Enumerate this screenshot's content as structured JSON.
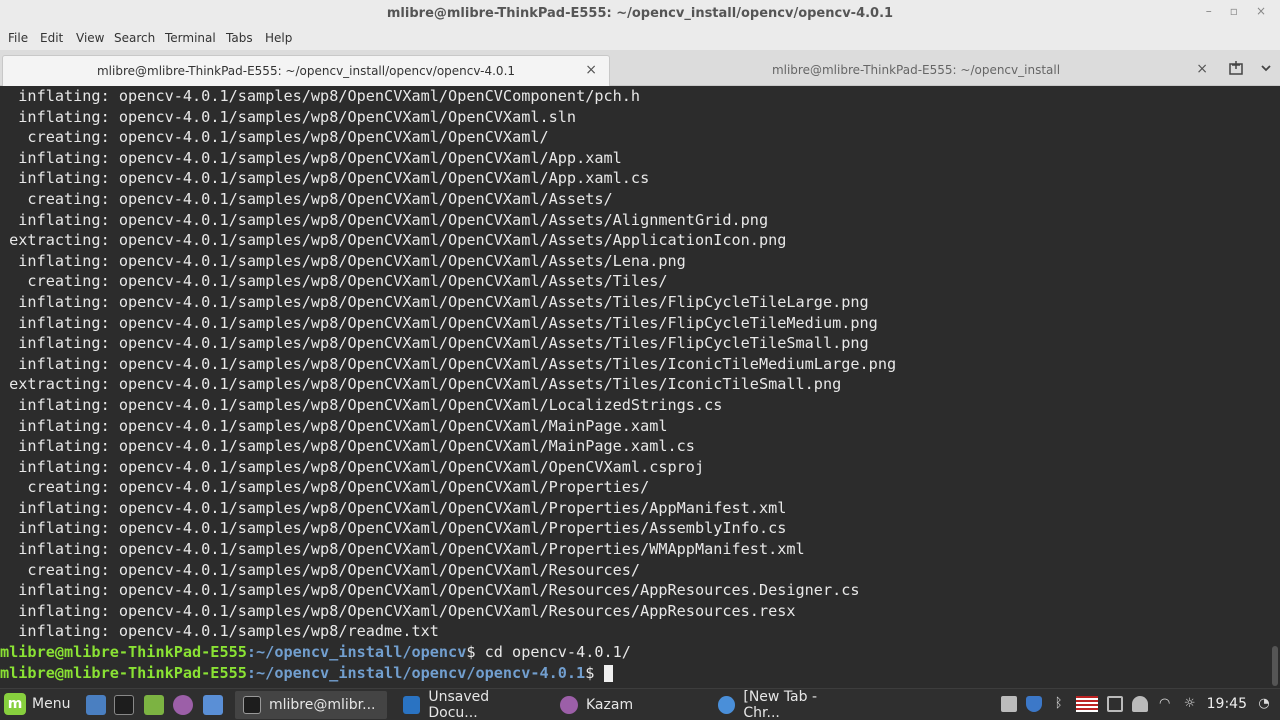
{
  "window": {
    "title": "mlibre@mlibre-ThinkPad-E555: ~/opencv_install/opencv/opencv-4.0.1",
    "controls": [
      "–",
      "▫",
      "×"
    ]
  },
  "menubar": [
    "File",
    "Edit",
    "View",
    "Search",
    "Terminal",
    "Tabs",
    "Help"
  ],
  "tabs": [
    {
      "label": "mlibre@mlibre-ThinkPad-E555: ~/opencv_install/opencv/opencv-4.0.1",
      "close": "×",
      "active": true
    },
    {
      "label": "mlibre@mlibre-ThinkPad-E555: ~/opencv_install",
      "close": "×",
      "active": false
    }
  ],
  "terminal": {
    "output": [
      {
        "verb": "  inflating:",
        "path": "opencv-4.0.1/samples/wp8/OpenCVXaml/OpenCVComponent/pch.h"
      },
      {
        "verb": "  inflating:",
        "path": "opencv-4.0.1/samples/wp8/OpenCVXaml/OpenCVXaml.sln"
      },
      {
        "verb": "   creating:",
        "path": "opencv-4.0.1/samples/wp8/OpenCVXaml/OpenCVXaml/"
      },
      {
        "verb": "  inflating:",
        "path": "opencv-4.0.1/samples/wp8/OpenCVXaml/OpenCVXaml/App.xaml"
      },
      {
        "verb": "  inflating:",
        "path": "opencv-4.0.1/samples/wp8/OpenCVXaml/OpenCVXaml/App.xaml.cs"
      },
      {
        "verb": "   creating:",
        "path": "opencv-4.0.1/samples/wp8/OpenCVXaml/OpenCVXaml/Assets/"
      },
      {
        "verb": "  inflating:",
        "path": "opencv-4.0.1/samples/wp8/OpenCVXaml/OpenCVXaml/Assets/AlignmentGrid.png"
      },
      {
        "verb": " extracting:",
        "path": "opencv-4.0.1/samples/wp8/OpenCVXaml/OpenCVXaml/Assets/ApplicationIcon.png"
      },
      {
        "verb": "  inflating:",
        "path": "opencv-4.0.1/samples/wp8/OpenCVXaml/OpenCVXaml/Assets/Lena.png"
      },
      {
        "verb": "   creating:",
        "path": "opencv-4.0.1/samples/wp8/OpenCVXaml/OpenCVXaml/Assets/Tiles/"
      },
      {
        "verb": "  inflating:",
        "path": "opencv-4.0.1/samples/wp8/OpenCVXaml/OpenCVXaml/Assets/Tiles/FlipCycleTileLarge.png"
      },
      {
        "verb": "  inflating:",
        "path": "opencv-4.0.1/samples/wp8/OpenCVXaml/OpenCVXaml/Assets/Tiles/FlipCycleTileMedium.png"
      },
      {
        "verb": "  inflating:",
        "path": "opencv-4.0.1/samples/wp8/OpenCVXaml/OpenCVXaml/Assets/Tiles/FlipCycleTileSmall.png"
      },
      {
        "verb": "  inflating:",
        "path": "opencv-4.0.1/samples/wp8/OpenCVXaml/OpenCVXaml/Assets/Tiles/IconicTileMediumLarge.png"
      },
      {
        "verb": " extracting:",
        "path": "opencv-4.0.1/samples/wp8/OpenCVXaml/OpenCVXaml/Assets/Tiles/IconicTileSmall.png"
      },
      {
        "verb": "  inflating:",
        "path": "opencv-4.0.1/samples/wp8/OpenCVXaml/OpenCVXaml/LocalizedStrings.cs"
      },
      {
        "verb": "  inflating:",
        "path": "opencv-4.0.1/samples/wp8/OpenCVXaml/OpenCVXaml/MainPage.xaml"
      },
      {
        "verb": "  inflating:",
        "path": "opencv-4.0.1/samples/wp8/OpenCVXaml/OpenCVXaml/MainPage.xaml.cs"
      },
      {
        "verb": "  inflating:",
        "path": "opencv-4.0.1/samples/wp8/OpenCVXaml/OpenCVXaml/OpenCVXaml.csproj"
      },
      {
        "verb": "   creating:",
        "path": "opencv-4.0.1/samples/wp8/OpenCVXaml/OpenCVXaml/Properties/"
      },
      {
        "verb": "  inflating:",
        "path": "opencv-4.0.1/samples/wp8/OpenCVXaml/OpenCVXaml/Properties/AppManifest.xml"
      },
      {
        "verb": "  inflating:",
        "path": "opencv-4.0.1/samples/wp8/OpenCVXaml/OpenCVXaml/Properties/AssemblyInfo.cs"
      },
      {
        "verb": "  inflating:",
        "path": "opencv-4.0.1/samples/wp8/OpenCVXaml/OpenCVXaml/Properties/WMAppManifest.xml"
      },
      {
        "verb": "   creating:",
        "path": "opencv-4.0.1/samples/wp8/OpenCVXaml/OpenCVXaml/Resources/"
      },
      {
        "verb": "  inflating:",
        "path": "opencv-4.0.1/samples/wp8/OpenCVXaml/OpenCVXaml/Resources/AppResources.Designer.cs"
      },
      {
        "verb": "  inflating:",
        "path": "opencv-4.0.1/samples/wp8/OpenCVXaml/OpenCVXaml/Resources/AppResources.resx"
      },
      {
        "verb": "  inflating:",
        "path": "opencv-4.0.1/samples/wp8/readme.txt"
      }
    ],
    "prompts": [
      {
        "user": "mlibre@mlibre-ThinkPad-E555",
        "path": ":~/opencv_install/opencv",
        "cmd": "$ cd opencv-4.0.1/"
      },
      {
        "user": "mlibre@mlibre-ThinkPad-E555",
        "path": ":~/opencv_install/opencv/opencv-4.0.1",
        "cmd": "$ "
      }
    ],
    "colors": {
      "user": "#8ae234",
      "path": "#729fcf",
      "text": "#e8e8e8",
      "background": "#2c2c2c"
    }
  },
  "taskbar": {
    "menu_label": "Menu",
    "tasks": [
      {
        "label": "mlibre@mlibr...",
        "icon": "terminal-icon",
        "active": true
      },
      {
        "label": "Unsaved Docu...",
        "icon": "code-editor-icon",
        "active": false
      },
      {
        "label": "Kazam",
        "icon": "kazam-icon",
        "active": false
      },
      {
        "label": "[New Tab - Chr...",
        "icon": "chromium-icon",
        "active": false
      }
    ],
    "clock": "19:45"
  }
}
